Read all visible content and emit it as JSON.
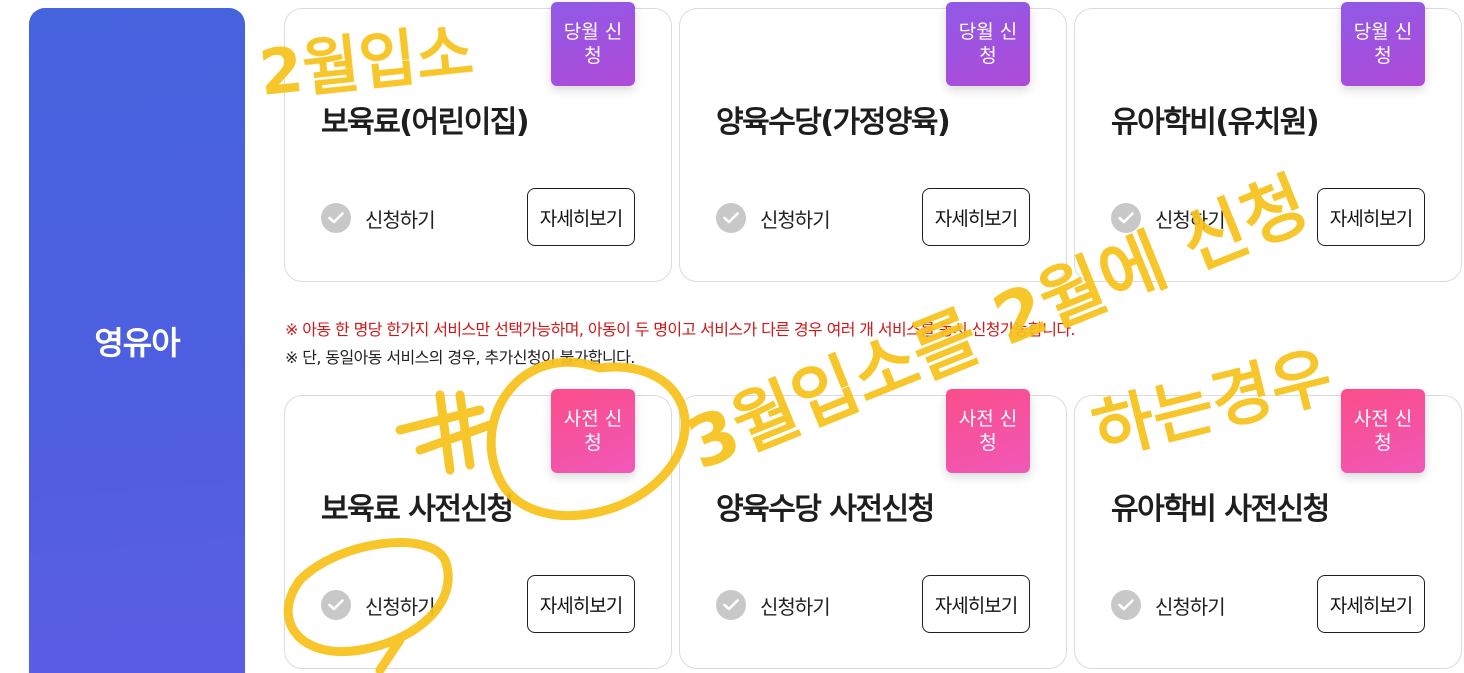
{
  "side_label": "영유아",
  "row1": [
    {
      "badge": "당월 신청",
      "title": "보육료(어린이집)",
      "apply": "신청하기",
      "detail": "자세히보기"
    },
    {
      "badge": "당월 신청",
      "title": "양육수당(가정양육)",
      "apply": "신청하기",
      "detail": "자세히보기"
    },
    {
      "badge": "당월 신청",
      "title": "유아학비(유치원)",
      "apply": "신청하기",
      "detail": "자세히보기"
    }
  ],
  "notices": [
    "※ 아동 한 명당 한가지 서비스만 선택가능하며, 아동이 두 명이고 서비스가 다른 경우 여러 개 서비스를 동시 신청가능합니다.",
    "※ 단, 동일아동 서비스의 경우, 추가신청이 불가합니다."
  ],
  "row2": [
    {
      "badge": "사전 신청",
      "title": "보육료 사전신청",
      "apply": "신청하기",
      "detail": "자세히보기"
    },
    {
      "badge": "사전 신청",
      "title": "양육수당 사전신청",
      "apply": "신청하기",
      "detail": "자세히보기"
    },
    {
      "badge": "사전 신청",
      "title": "유아학비 사전신청",
      "apply": "신청하기",
      "detail": "자세히보기"
    }
  ],
  "annotations": {
    "feb": "2월입소",
    "mar": "3월입소를 2월에 신청",
    "case": "하는경우",
    "color": "#f7c21b"
  },
  "colors": {
    "side_panel": "#4b60df",
    "badge_current": "#a552dc",
    "badge_pre": "#f94f9a",
    "notice_red": "#d11818"
  }
}
